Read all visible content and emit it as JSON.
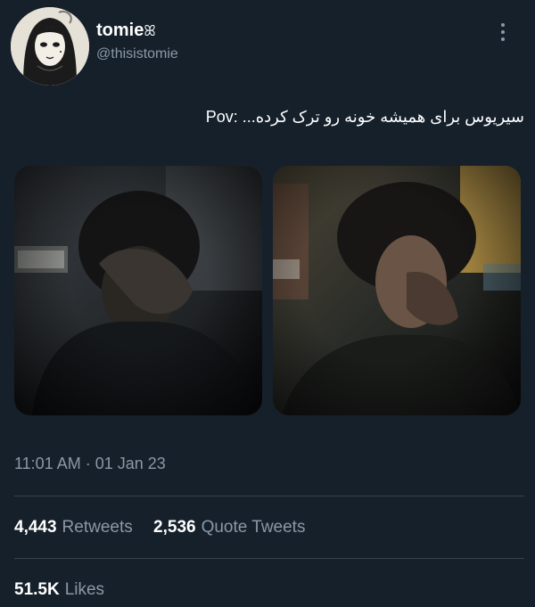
{
  "author": {
    "display_name": "tomie",
    "display_name_suffix": " ⌢",
    "handle": "@thisistomie"
  },
  "tweet": {
    "text": "سیریوس برای همیشه خونه رو ترک کرده... :Pov",
    "timestamp": "11:01 AM · 01 Jan 23"
  },
  "engagement": {
    "retweets_count": "4,443",
    "retweets_label": "Retweets",
    "quotes_count": "2,536",
    "quotes_label": "Quote Tweets",
    "likes_count": "51.5K",
    "likes_label": "Likes"
  },
  "icons": {
    "more": "more-vertical-icon"
  },
  "colors": {
    "background": "#15202b",
    "secondary_text": "#8b98a5",
    "divider": "#38444d"
  }
}
